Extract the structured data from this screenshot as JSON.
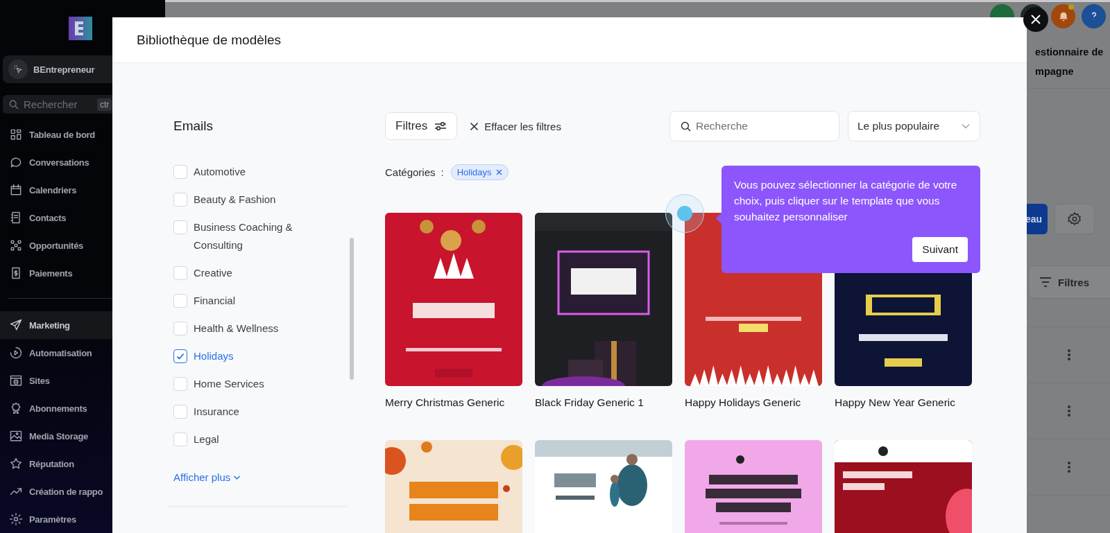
{
  "sidebar": {
    "brand": "BEntrepreneur",
    "search": {
      "placeholder": "Rechercher",
      "shortcut": "ctr"
    },
    "sections": [
      [
        {
          "label": "Tableau de bord",
          "selected": false
        },
        {
          "label": "Conversations",
          "selected": false
        },
        {
          "label": "Calendriers",
          "selected": false
        },
        {
          "label": "Contacts",
          "selected": false
        },
        {
          "label": "Opportunités",
          "selected": false
        },
        {
          "label": "Paiements",
          "selected": false
        }
      ],
      [
        {
          "label": "Marketing",
          "selected": true
        },
        {
          "label": "Automatisation",
          "selected": false
        },
        {
          "label": "Sites",
          "selected": false
        },
        {
          "label": "Abonnements",
          "selected": false
        },
        {
          "label": "Media Storage",
          "selected": false
        },
        {
          "label": "Réputation",
          "selected": false
        },
        {
          "label": "Création de rappo",
          "selected": false
        },
        {
          "label": "Paramètres",
          "selected": false
        }
      ]
    ]
  },
  "background": {
    "header_lines": [
      "estionnaire de",
      "mpagne"
    ],
    "primary_button": "eau",
    "filter_button": "Filtres"
  },
  "modal": {
    "title": "Bibliothèque de modèles",
    "categories_panel": {
      "heading": "Emails",
      "options": [
        {
          "label": "Automotive",
          "checked": false
        },
        {
          "label": "Beauty & Fashion",
          "checked": false
        },
        {
          "label": "Business Coaching & Consulting",
          "checked": false
        },
        {
          "label": "Creative",
          "checked": false
        },
        {
          "label": "Financial",
          "checked": false
        },
        {
          "label": "Health & Wellness",
          "checked": false
        },
        {
          "label": "Holidays",
          "checked": true
        },
        {
          "label": "Home Services",
          "checked": false
        },
        {
          "label": "Insurance",
          "checked": false
        },
        {
          "label": "Legal",
          "checked": false
        }
      ],
      "show_more": "Afficher plus"
    },
    "toolbar": {
      "filters_button": "Filtres",
      "clear_filters": "Effacer les filtres",
      "search": {
        "placeholder": "Recherche"
      },
      "sort": "Le plus populaire"
    },
    "categories": {
      "label": "Catégories",
      "separator": ":",
      "chips": [
        {
          "label": "Holidays"
        }
      ]
    },
    "templates": [
      {
        "title": "Merry Christmas Generic",
        "kind": "picture"
      },
      {
        "title": "Black Friday Generic 1",
        "kind": "picture"
      },
      {
        "title": "Happy Holidays Generic",
        "kind": "picture"
      },
      {
        "title": "Happy New Year Generic",
        "kind": "picture"
      },
      {
        "kind": "picture"
      },
      {
        "kind": "picture"
      },
      {
        "kind": "picture"
      },
      {
        "kind": "picture"
      }
    ],
    "tooltip": {
      "text": "Vous pouvez sélectionner la catégorie de votre choix, puis cliquer sur le template que vous souhaitez personnaliser",
      "button": "Suivant"
    }
  }
}
